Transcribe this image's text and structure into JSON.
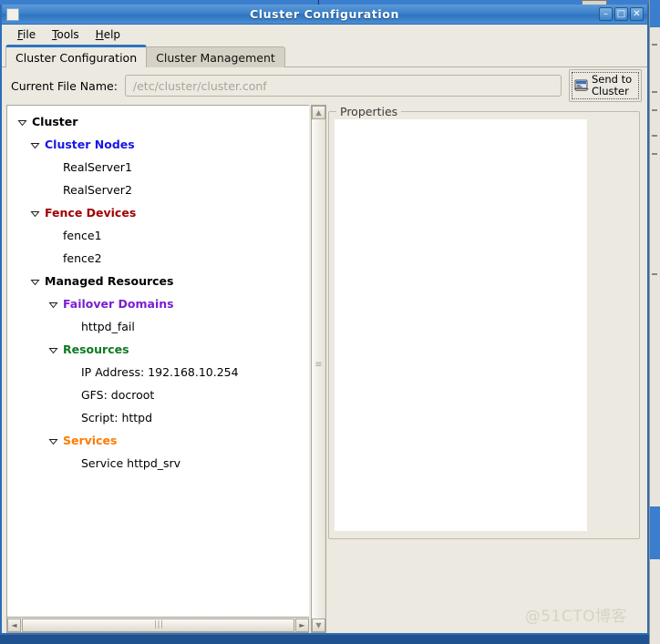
{
  "window": {
    "title": "Cluster Configuration",
    "sysmenu_icon": "window-menu-icon",
    "minimize_label": "–",
    "maximize_label": "□",
    "close_label": "✕"
  },
  "menubar": {
    "items": [
      {
        "label": "File",
        "mnemonic": "F",
        "rest": "ile"
      },
      {
        "label": "Tools",
        "mnemonic": "T",
        "rest": "ools"
      },
      {
        "label": "Help",
        "mnemonic": "H",
        "rest": "elp"
      }
    ]
  },
  "tabs": [
    {
      "label": "Cluster Configuration",
      "active": true
    },
    {
      "label": "Cluster Management",
      "active": false
    }
  ],
  "filerow": {
    "label": "Current File Name:",
    "value": "",
    "placeholder": "/etc/cluster/cluster.conf"
  },
  "send_button": {
    "line1": "Send to",
    "line2": "Cluster",
    "icon": "send-to-cluster-icon"
  },
  "tree": {
    "nodes": [
      {
        "label": "Cluster",
        "indent": 0,
        "expander": true,
        "bold": true,
        "color": "#000000"
      },
      {
        "label": "Cluster Nodes",
        "indent": 1,
        "expander": true,
        "bold": true,
        "color": "#1717e6"
      },
      {
        "label": "RealServer1",
        "indent": 2,
        "expander": false,
        "bold": false,
        "color": "#000000"
      },
      {
        "label": "RealServer2",
        "indent": 2,
        "expander": false,
        "bold": false,
        "color": "#000000"
      },
      {
        "label": "Fence Devices",
        "indent": 1,
        "expander": true,
        "bold": true,
        "color": "#a00000"
      },
      {
        "label": "fence1",
        "indent": 2,
        "expander": false,
        "bold": false,
        "color": "#000000"
      },
      {
        "label": "fence2",
        "indent": 2,
        "expander": false,
        "bold": false,
        "color": "#000000"
      },
      {
        "label": "Managed Resources",
        "indent": 1,
        "expander": true,
        "bold": true,
        "color": "#000000"
      },
      {
        "label": "Failover Domains",
        "indent": 2,
        "expander": true,
        "bold": true,
        "color": "#7a1ed2"
      },
      {
        "label": "httpd_fail",
        "indent": 3,
        "expander": false,
        "bold": false,
        "color": "#000000"
      },
      {
        "label": "Resources",
        "indent": 2,
        "expander": true,
        "bold": true,
        "color": "#0b7a23"
      },
      {
        "label": "IP Address:  192.168.10.254",
        "indent": 3,
        "expander": false,
        "bold": false,
        "color": "#000000"
      },
      {
        "label": "GFS:  docroot",
        "indent": 3,
        "expander": false,
        "bold": false,
        "color": "#000000"
      },
      {
        "label": "Script:  httpd",
        "indent": 3,
        "expander": false,
        "bold": false,
        "color": "#000000"
      },
      {
        "label": "Services",
        "indent": 2,
        "expander": true,
        "bold": true,
        "color": "#ff7b00"
      },
      {
        "label": "Service httpd_srv",
        "indent": 3,
        "expander": false,
        "bold": false,
        "color": "#000000"
      }
    ]
  },
  "scrollbars": {
    "v_up_arrow": "▲",
    "v_down_arrow": "▼",
    "h_left_arrow": "◄",
    "h_right_arrow": "►",
    "h_thumb_grip": "∣∣∣",
    "v_split_grip": "≡"
  },
  "properties": {
    "legend": "Properties",
    "content": ""
  },
  "watermark": "@51CTO博客",
  "colors": {
    "titlebar_blue": "#3c81c9",
    "active_tab_accent": "#2f74bf",
    "window_bg": "#ece9e1",
    "tree_bg": "#ffffff",
    "border": "#a9a49a"
  }
}
